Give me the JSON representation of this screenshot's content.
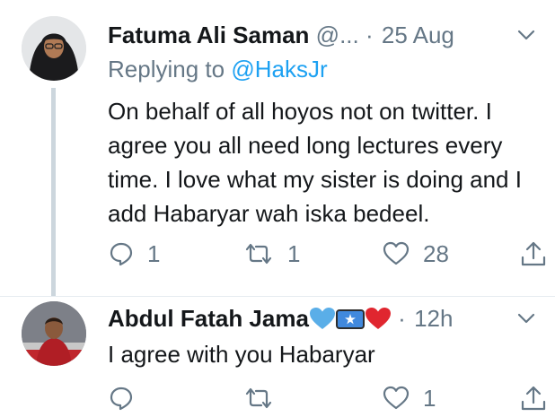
{
  "tweets": [
    {
      "name": "Fatuma Ali Saman",
      "handle": "@...",
      "separator": "·",
      "time": "25 Aug",
      "replying_prefix": "Replying to",
      "replying_handle": "@HaksJr",
      "text": "On behalf of all hoyos not on twitter. I agree you all need long lectures every time. I love what my sister is doing and I add Habaryar wah iska bedeel.",
      "actions": {
        "replies": "1",
        "retweets": "1",
        "likes": "28"
      }
    },
    {
      "name": "Abdul Fatah Jama",
      "name_emoji": [
        "blue-heart",
        "somalia-flag",
        "red-heart"
      ],
      "separator": "·",
      "time": "12h",
      "text": "I agree with you Habaryar",
      "actions": {
        "replies": "",
        "retweets": "",
        "likes": "1"
      }
    }
  ],
  "colors": {
    "link": "#1da1f2",
    "secondary": "#657786",
    "thread_line": "#ccd6dd"
  }
}
